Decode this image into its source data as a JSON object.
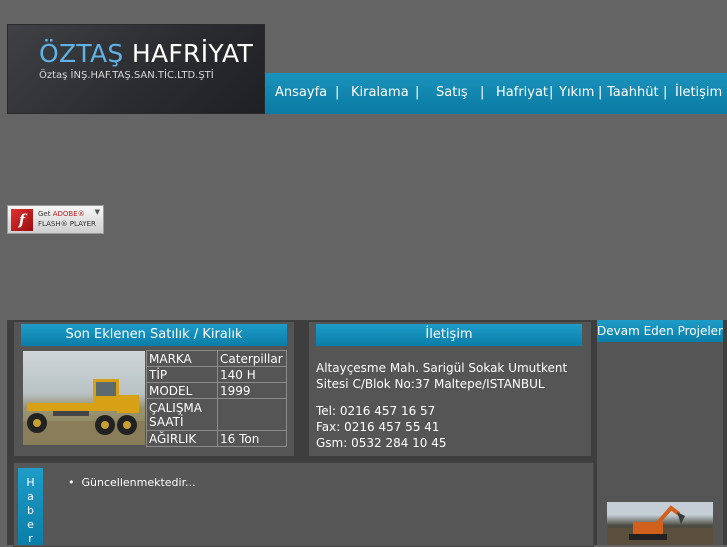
{
  "header": {
    "logo_brand": "ÖZTAŞ",
    "logo_word": "HAFRİYAT",
    "logo_subtitle": "Öztaş İNŞ.HAF.TAŞ.SAN.TİC.LTD.ŞTİ"
  },
  "nav": {
    "items": [
      {
        "label": "Ansayfa"
      },
      {
        "label": "Kiralama"
      },
      {
        "label": "Satış"
      },
      {
        "label": "Hafriyat"
      },
      {
        "label": "Yıkım"
      },
      {
        "label": "Taahhüt"
      },
      {
        "label": "İletişim"
      }
    ],
    "separator": "|"
  },
  "flash_badge": {
    "get": "Get",
    "adobe": "ADOBE®",
    "player": "FLASH® PLAYER",
    "logo_glyph": "f"
  },
  "latest": {
    "title": "Son Eklenen Satılık / Kiralık",
    "specs": [
      {
        "label": "MARKA",
        "value": "Caterpillar"
      },
      {
        "label": "TİP",
        "value": "140 H"
      },
      {
        "label": "MODEL",
        "value": "1999"
      },
      {
        "label": "ÇALIŞMA SAATİ",
        "value": ""
      },
      {
        "label": "AĞIRLIK",
        "value": "16 Ton"
      }
    ]
  },
  "contact": {
    "title": "İletişim",
    "address_line1": "Altayçesme Mah. Sarigül Sokak Umutkent",
    "address_line2": "Sitesi C/Blok No:37 Maltepe/ISTANBUL",
    "tel": "Tel:   0216 457 16 57",
    "fax": "Fax:  0216 457 55 41",
    "gsm": "Gsm: 0532 284 10 45"
  },
  "projects": {
    "title": "Devam Eden Projeler"
  },
  "news": {
    "tab_letters": [
      "H",
      "a",
      "b",
      "e",
      "r"
    ],
    "items": [
      "Güncellenmektedir..."
    ]
  },
  "colors": {
    "background": "#646464",
    "accent_blue": "#1a93bd",
    "panel": "#555555"
  }
}
